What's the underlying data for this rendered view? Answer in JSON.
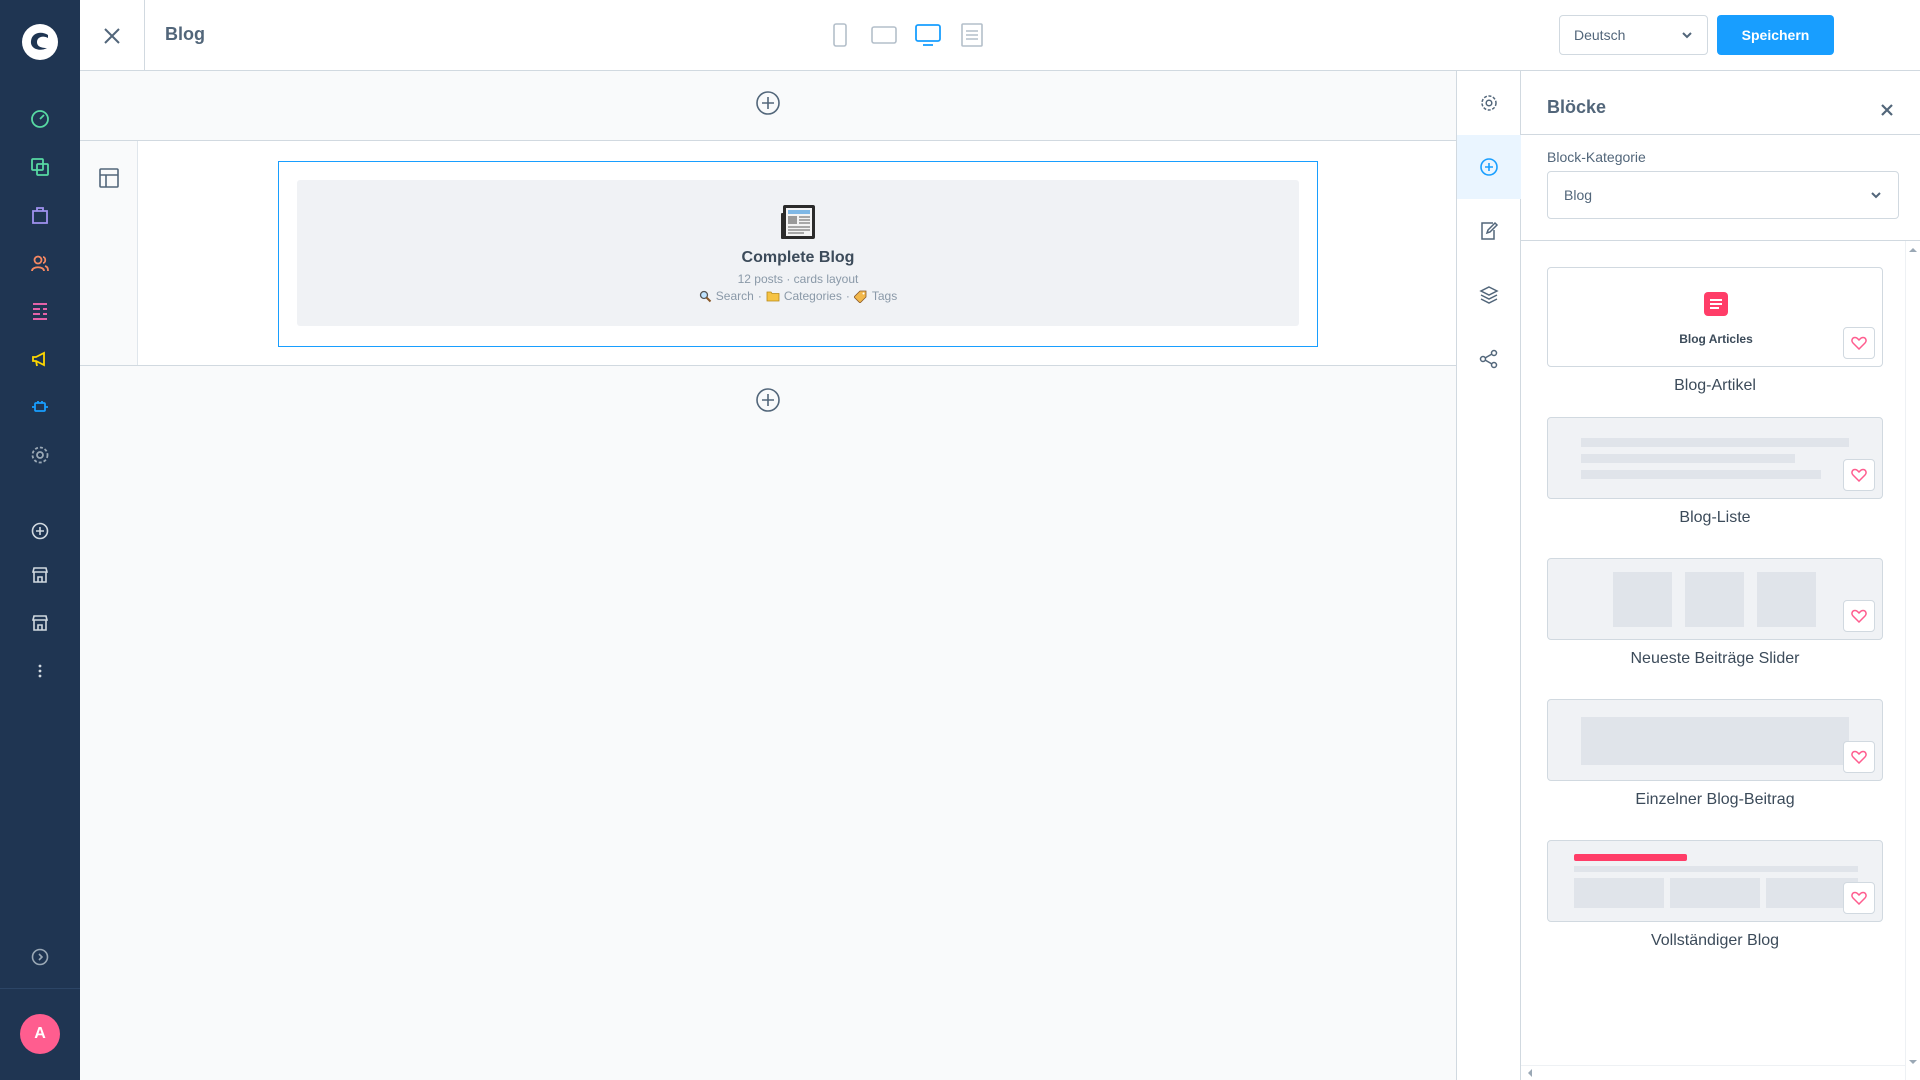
{
  "app": {
    "page_title": "Blog",
    "language": "Deutsch",
    "save_label": "Speichern",
    "avatar_initial": "A",
    "accent_color": "#189eff",
    "sidebar_color": "#1f3552"
  },
  "admin_nav": {
    "icons": [
      "dashboard-icon",
      "catalog-icon",
      "orders-icon",
      "customers-icon",
      "content-icon",
      "marketing-icon",
      "extensions-icon",
      "settings-icon",
      "add-icon",
      "sales-channel-icon",
      "sales-channel-icon",
      "more-icon",
      "expand-icon"
    ]
  },
  "device_switch": {
    "options": [
      "mobile",
      "tablet",
      "desktop",
      "form"
    ],
    "active": "desktop"
  },
  "canvas": {
    "block": {
      "title": "Complete Blog",
      "meta": "12 posts · cards layout",
      "features": [
        "Search",
        "Categories",
        "Tags"
      ],
      "separator": "·"
    }
  },
  "tool_rail": {
    "tools": [
      "settings",
      "add-block",
      "edit",
      "layers",
      "share"
    ],
    "active": "add-block"
  },
  "blocks_panel": {
    "title": "Blöcke",
    "category_label": "Block-Kategorie",
    "category_value": "Blog",
    "blocks": [
      {
        "label": "Blog-Artikel",
        "preview_text": "Blog Articles"
      },
      {
        "label": "Blog-Liste"
      },
      {
        "label": "Neueste Beiträge Slider"
      },
      {
        "label": "Einzelner Blog-Beitrag"
      },
      {
        "label": "Vollständiger Blog"
      }
    ]
  }
}
